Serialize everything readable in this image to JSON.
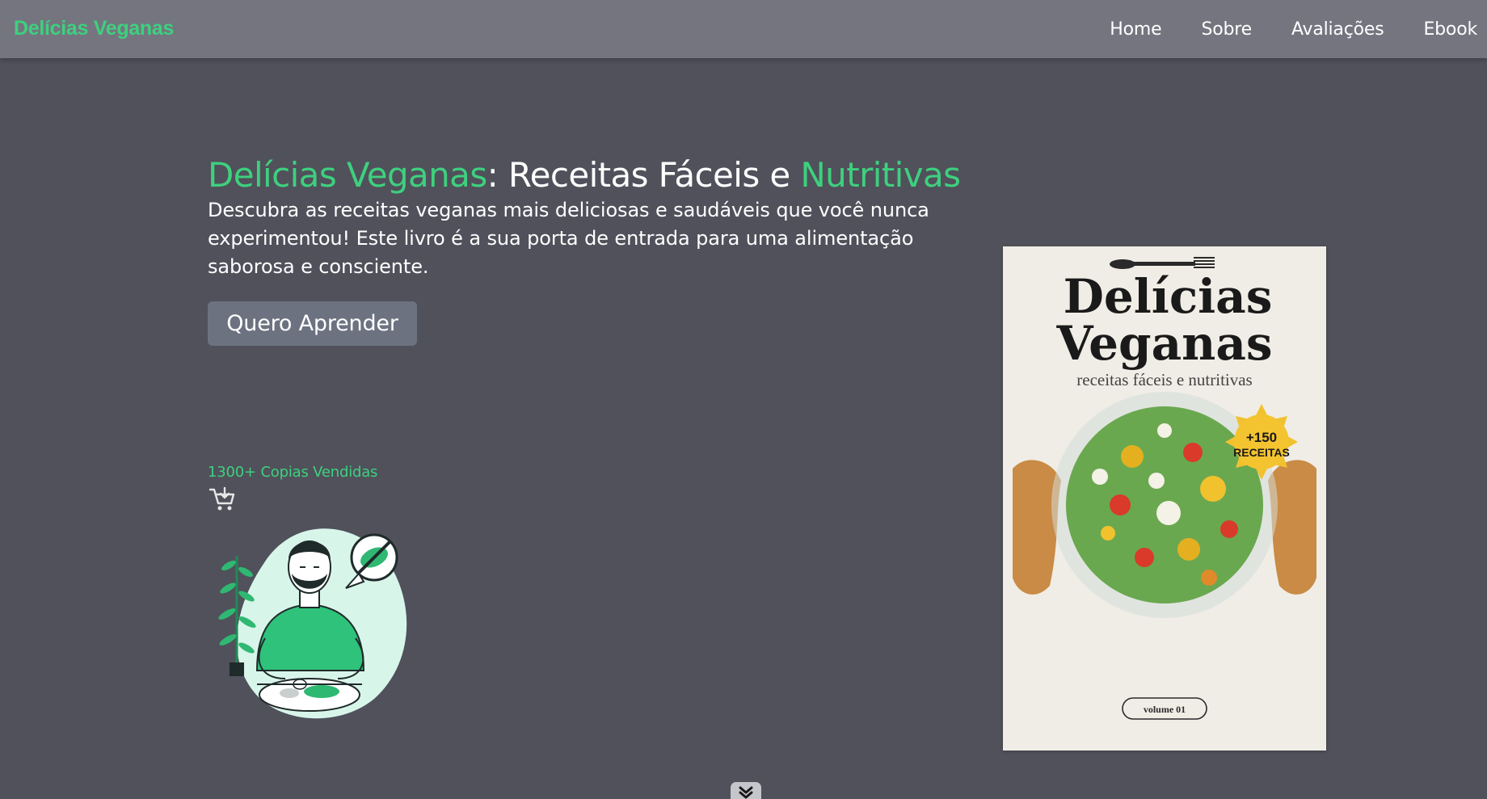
{
  "navbar": {
    "brand": "Delícias Veganas",
    "links": [
      "Home",
      "Sobre",
      "Avaliações",
      "Ebook"
    ]
  },
  "hero": {
    "title_part1": "Delícias Veganas",
    "title_part2": ": Receitas Fáceis e ",
    "title_part3": "Nutritivas",
    "description": "Descubra as receitas veganas mais deliciosas e saudáveis que você nunca experimentou! Este livro é a sua porta de entrada para uma alimentação saborosa e consciente.",
    "cta_label": "Quero Aprender"
  },
  "sales": {
    "count": "1300+",
    "label": "Copias Vendidas"
  },
  "icons": {
    "cart": "cart-plus-icon",
    "scroll": "chevron-double-down-icon"
  },
  "book": {
    "title_line1": "Delícias",
    "title_line2": "Veganas",
    "subtitle": "receitas fáceis e nutritivas",
    "badge_line1": "+150",
    "badge_line2": "RECEITAS",
    "volume": "volume 01"
  },
  "colors": {
    "accent": "#3ed07e",
    "background": "#50515b",
    "navbar": "#74757f",
    "button": "#6c7280"
  }
}
